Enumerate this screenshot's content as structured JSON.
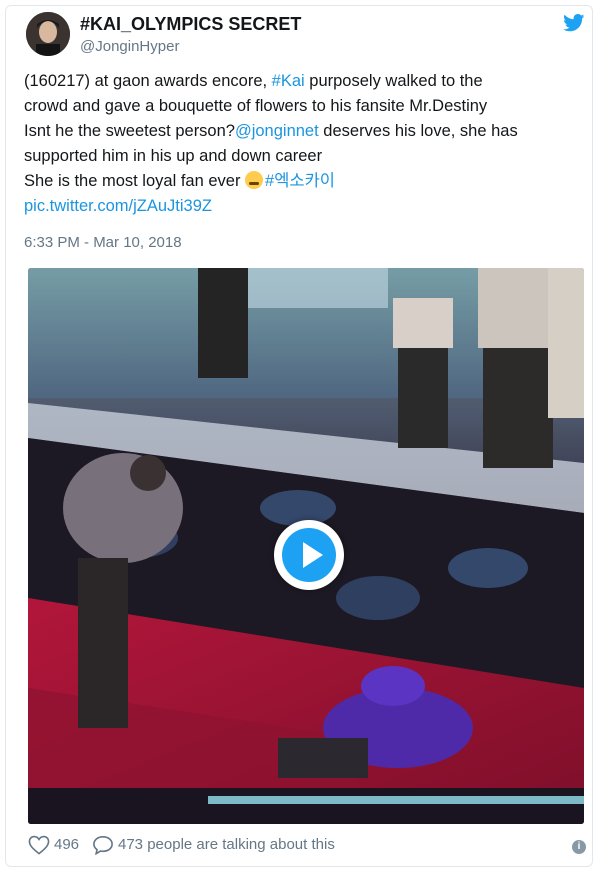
{
  "tweet": {
    "display_name": "#KAI_OLYMPICS SECRET",
    "handle": "@JonginHyper",
    "text": {
      "line1_a": "(160217) at gaon awards encore, ",
      "line1_hashtag": "#Kai",
      "line1_b": " purposely walked to the",
      "line2": "crowd and gave a bouquette of flowers to his fansite Mr.Destiny",
      "line3_a": "Isnt he the sweetest person?",
      "line3_mention": "@jonginnet",
      "line3_b": " deserves his love, she has",
      "line4": "supported him in his up and down career",
      "line5_a": "She is the most loyal fan ever ",
      "line5_hashtag": "#엑소카이",
      "link": "pic.twitter.com/jZAuJti39Z"
    },
    "timestamp": "6:33 PM - Mar 10, 2018",
    "likes": "496",
    "talking": "473 people are talking about this"
  },
  "icons": {
    "bird": "twitter-bird-icon",
    "play": "play-icon",
    "heart": "heart-icon",
    "reply": "speech-bubble-icon",
    "info": "info-icon",
    "emoji": "steam-from-nose-emoji"
  },
  "colors": {
    "link": "#1b95e0",
    "brand": "#1da1f2",
    "meta": "#657786"
  }
}
